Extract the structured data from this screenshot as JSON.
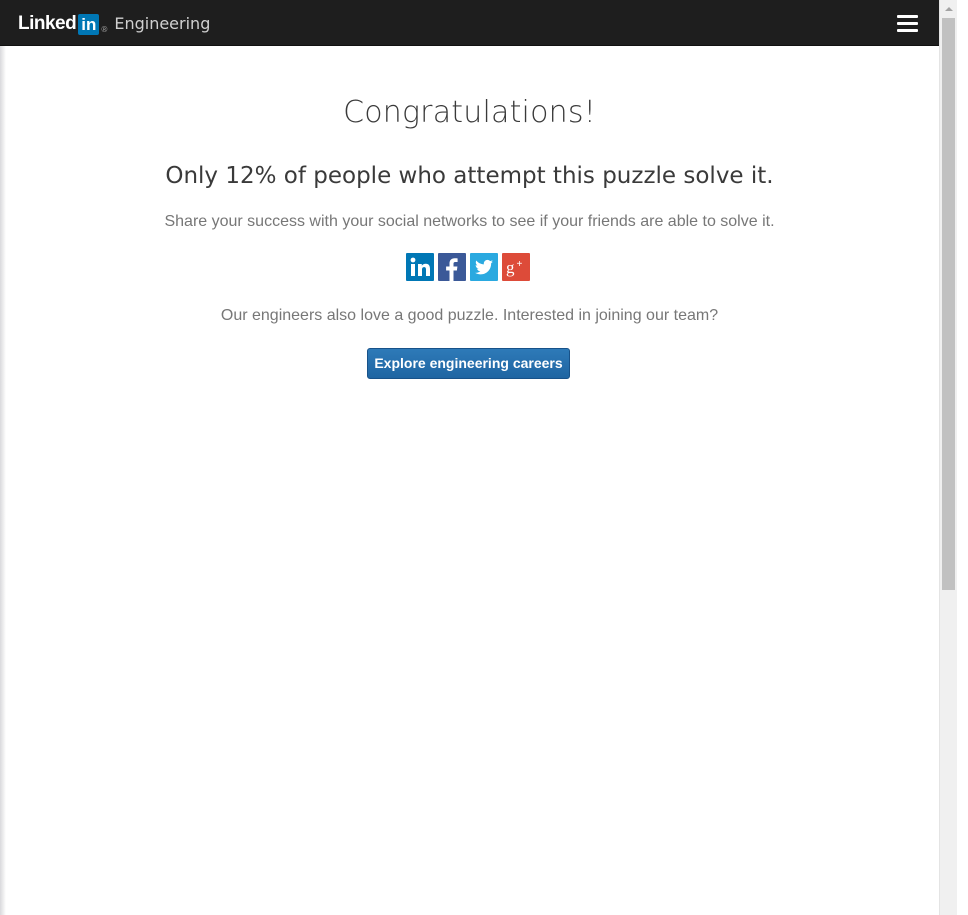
{
  "header": {
    "brand_linked": "Linked",
    "brand_in": "in",
    "brand_registered": "®",
    "brand_section": "Engineering",
    "menu_icon": "hamburger-menu-icon"
  },
  "main": {
    "headline": "Congratulations!",
    "subheadline": "Only 12% of people who attempt this puzzle solve it.",
    "share_prompt": "Share your success with your social networks to see if your friends are able to solve it.",
    "social_icons": [
      {
        "name": "linkedin-icon",
        "glyph": "in",
        "color": "#0077b5"
      },
      {
        "name": "facebook-icon",
        "glyph": "f",
        "color": "#3b5998"
      },
      {
        "name": "twitter-icon",
        "glyph": "bird",
        "color": "#2aa9e0"
      },
      {
        "name": "google-plus-icon",
        "glyph": "g+",
        "color": "#dd4b39"
      }
    ],
    "careers_prompt": "Our engineers also love a good puzzle. Interested in joining our team?",
    "careers_button_label": "Explore engineering careers"
  },
  "colors": {
    "navbar": "#1e1e1e",
    "button": "#2a72b0",
    "linkedin_blue": "#0077b5"
  }
}
